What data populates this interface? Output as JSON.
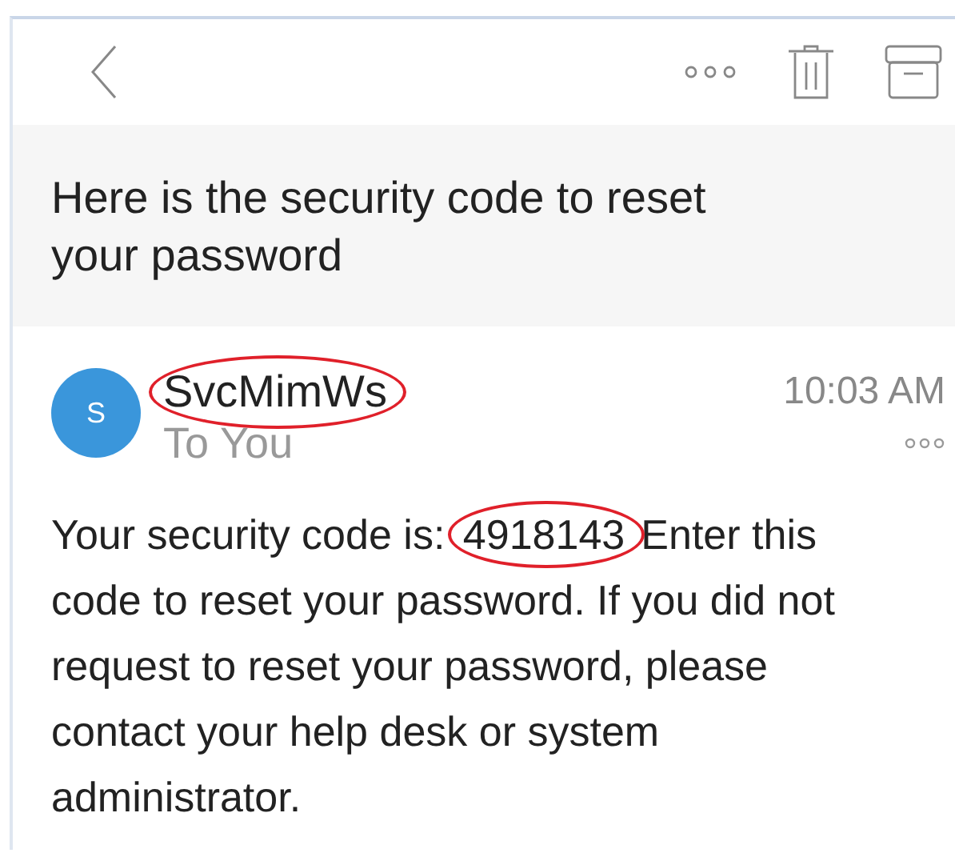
{
  "subject": "Here is the security code to reset your password",
  "message": {
    "avatar_letter": "S",
    "sender": "SvcMimWs",
    "sender_circled": true,
    "time": "10:03 AM",
    "recipient": "To You",
    "body_before": "Your security code is:",
    "code": "4918143",
    "code_circled": true,
    "body_after": "Enter this code to reset your password. If you did not request to reset your password, please contact your help desk or system administrator."
  }
}
